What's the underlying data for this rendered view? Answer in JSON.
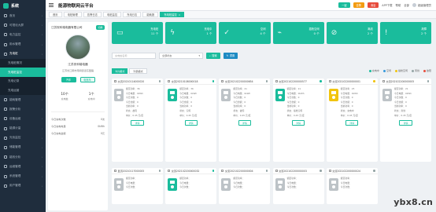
{
  "app": {
    "title": "能源物联网云平台",
    "logo": "系统"
  },
  "topbar": {
    "btn_green": "一键",
    "btn_orange": "告警",
    "btn_red": "消息",
    "app_download": "APP下载",
    "help": "帮助",
    "lang": "全部",
    "user": "超级管理员"
  },
  "sidebar": {
    "items": [
      {
        "label": "首页",
        "icon": "home-icon"
      },
      {
        "label": "可视化大屏",
        "icon": "screen-icon"
      },
      {
        "label": "电力监控",
        "icon": "power-icon"
      },
      {
        "label": "用水管理",
        "icon": "water-icon"
      },
      {
        "label": "充电桩",
        "icon": "charger-icon"
      }
    ],
    "sub": [
      {
        "label": "充电桩概况",
        "active": false
      },
      {
        "label": "充电桩监控",
        "active": true
      },
      {
        "label": "充电记录",
        "active": false
      },
      {
        "label": "充电运营",
        "active": false
      }
    ],
    "items2": [
      {
        "label": "能耗管理",
        "icon": "energy-icon"
      },
      {
        "label": "报警分析",
        "icon": "alarm-icon"
      },
      {
        "label": "设备运维",
        "icon": "device-icon"
      },
      {
        "label": "能源计量",
        "icon": "meter-icon"
      },
      {
        "label": "光伏监控",
        "icon": "solar-icon"
      },
      {
        "label": "储能管理",
        "icon": "battery-icon"
      },
      {
        "label": "能效分析",
        "icon": "chart-icon"
      },
      {
        "label": "运维管理",
        "icon": "tool-icon"
      },
      {
        "label": "系统管理",
        "icon": "settings-icon"
      },
      {
        "label": "用户管理",
        "icon": "user-icon"
      }
    ]
  },
  "tabs": [
    {
      "label": "首页",
      "active": false
    },
    {
      "label": "电桩管理",
      "active": false
    },
    {
      "label": "告警日志",
      "active": false
    },
    {
      "label": "电桩监控",
      "active": false
    },
    {
      "label": "充电日志",
      "active": false
    },
    {
      "label": "能耗报",
      "active": false
    },
    {
      "label": "充电桩监控",
      "active": true
    }
  ],
  "station": {
    "name": "江苏安科瑞电器有限公司",
    "badge": "切换",
    "title": "江苏安科瑞电器",
    "address": "江苏省江阴市南闸街道东盟路",
    "btn_primary": "汽车",
    "btn_secondary": "电瓶车",
    "stats": [
      {
        "num": "10个",
        "label": "充电桩"
      },
      {
        "num": "1个",
        "label": "充电中"
      }
    ],
    "rows": [
      {
        "label": "今日充电次数",
        "value": "0次"
      },
      {
        "label": "今日充电电量",
        "value": "0kWh"
      },
      {
        "label": "今日充电金额",
        "value": "0元"
      }
    ]
  },
  "summary": [
    {
      "label": "充电桩",
      "value": "11 个",
      "icon": "plug-icon"
    },
    {
      "label": "充电中",
      "value": "1 个",
      "icon": "bolt-icon"
    },
    {
      "label": "空闲",
      "value": "4 个",
      "icon": "check-icon"
    },
    {
      "label": "插枪空闲",
      "value": "0 个",
      "icon": "gun-icon"
    },
    {
      "label": "离线",
      "value": "2 个",
      "icon": "offline-icon"
    },
    {
      "label": "故障",
      "value": "2 个",
      "icon": "warning-icon"
    }
  ],
  "filters": {
    "name_placeholder": "充电桩名称",
    "status_select": "全部状态",
    "search": "搜索",
    "reset": "重置"
  },
  "view": {
    "card": "卡片模式",
    "list": "列表模式"
  },
  "legend": [
    {
      "label": "充电中",
      "color": "#1abc9c"
    },
    {
      "label": "空闲",
      "color": "#3498db"
    },
    {
      "label": "插枪空闲",
      "color": "#f1c40f"
    },
    {
      "label": "离线",
      "color": "#95a5a6"
    },
    {
      "label": "故障",
      "color": "#e74c3c"
    }
  ],
  "piles_row1": [
    {
      "id": "交流20210114000020",
      "color": "#bdc3c7",
      "power": "36",
      "v": "0kWh",
      "cnt": "0",
      "amt": "0",
      "kw": "0",
      "state": "故障",
      "price": "0.45 元/度"
    },
    {
      "id": "交流20210108000018",
      "color": "#1abc9c",
      "power": "36",
      "v": "0kWh",
      "cnt": "0",
      "amt": "0",
      "kw": "0",
      "state": "空闲",
      "price": "0.45 元/度"
    },
    {
      "id": "交流202102200000654",
      "color": "#bdc3c7",
      "power": "21",
      "v": "0kWh",
      "cnt": "0",
      "amt": "0",
      "kw": "0",
      "state": "故障",
      "price": "0.45 元/度"
    },
    {
      "id": "交流202102200000577",
      "color": "#1abc9c",
      "power": "21",
      "v": "0kWh",
      "cnt": "0",
      "amt": "0",
      "kw": "0",
      "state": "插枪空闲",
      "price": "0.45 元/度"
    },
    {
      "id": "交流202102200000001",
      "color": "#f1c40f",
      "power": "25",
      "v": "0kWh",
      "cnt": "0",
      "amt": "0",
      "kw": "0",
      "state": "充电中",
      "price": "0.45 元/度"
    },
    {
      "id": "交流202102200000005",
      "color": "#bdc3c7",
      "power": "21",
      "v": "0kWh",
      "cnt": "0",
      "amt": "0",
      "kw": "0",
      "state": "离线",
      "price": "0.45 元/度"
    }
  ],
  "piles_row2": [
    {
      "id": "直流20210117000005",
      "color": "#bdc3c7"
    },
    {
      "id": "交流202102200000032",
      "color": "#1abc9c"
    },
    {
      "id": "交流202102200000004",
      "color": "#bdc3c7"
    },
    {
      "id": "交流202102200000003",
      "color": "#bdc3c7"
    },
    {
      "id": "交流202102200000024",
      "color": "#bdc3c7"
    }
  ],
  "pile_labels": {
    "power": "额定功率：",
    "v": "今日电量：",
    "cnt": "今日次数：",
    "amt": "今日金额：",
    "kw": "当前功率：",
    "state": "状态：",
    "price": "单价：",
    "detail": "详情"
  },
  "watermark": "ybx8.cn"
}
